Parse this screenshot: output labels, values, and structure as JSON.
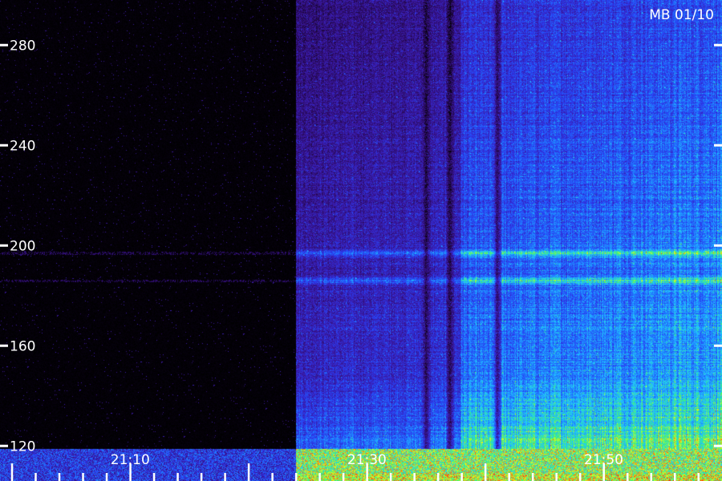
{
  "chart_data": {
    "type": "heatmap",
    "title": "",
    "xlabel": "",
    "ylabel": "",
    "stamp": "MB 01/10",
    "y_ticks": [
      "280",
      "240",
      "200",
      "160",
      "120"
    ],
    "y_tick_values": [
      280,
      240,
      200,
      160,
      120
    ],
    "x_ticks": [
      "21:10",
      "21:30",
      "21:50"
    ],
    "ylim": [
      106,
      298
    ],
    "xlim": [
      "20:59",
      "22:00"
    ],
    "data_start": "21:24",
    "colormap": [
      "#000000",
      "#2a0a5e",
      "#3a1aa8",
      "#2a3cf0",
      "#1f7cff",
      "#22c8ff",
      "#3cf07a",
      "#e0ff20",
      "#ff3010"
    ],
    "notable_bands_y": [
      197,
      186
    ],
    "dark_columns_x": [
      "21:35",
      "21:37",
      "21:41"
    ]
  }
}
